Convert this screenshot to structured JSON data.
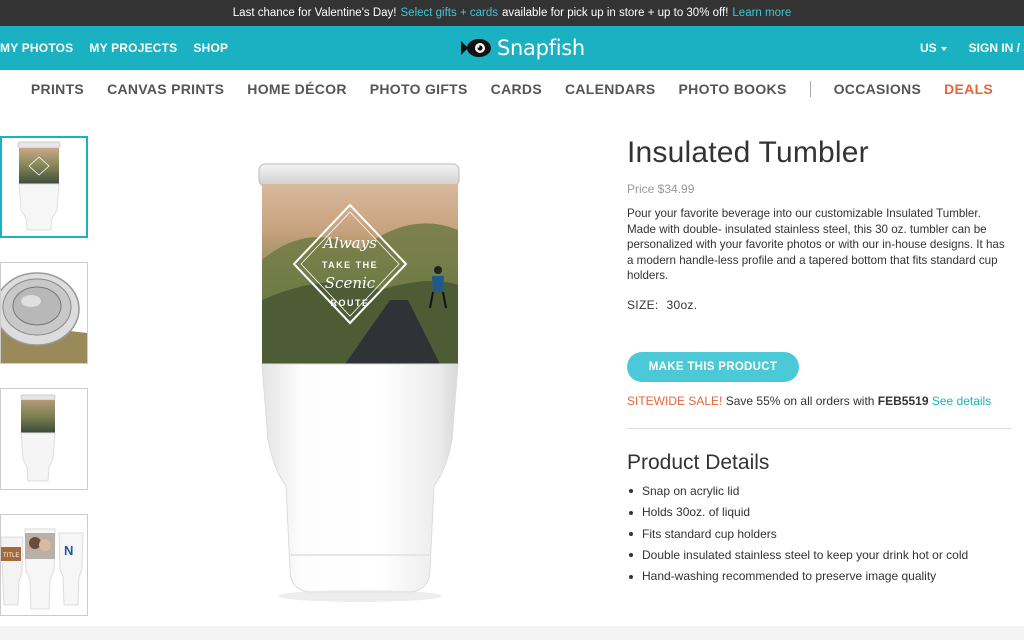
{
  "promo": {
    "text_a": "Last chance for Valentine's Day!",
    "link": "Select gifts + cards",
    "text_b": "available for pick up in store + up to 30% off!",
    "learn_more": "Learn more"
  },
  "topnav": {
    "items": [
      "MY PHOTOS",
      "MY PROJECTS",
      "SHOP"
    ],
    "brand": "Snapfish",
    "region": "US",
    "sign_in": "SIGN IN / J"
  },
  "catnav": {
    "items": [
      "PRINTS",
      "CANVAS PRINTS",
      "HOME DÉCOR",
      "PHOTO GIFTS",
      "CARDS",
      "CALENDARS",
      "PHOTO BOOKS"
    ],
    "occasions": "OCCASIONS",
    "deals": "DEALS"
  },
  "hero": {
    "design_line1": "Always",
    "design_line2": "TAKE THE",
    "design_line3": "Scenic",
    "design_line4": "ROUTE"
  },
  "product": {
    "title": "Insulated Tumbler",
    "price": "Price $34.99",
    "description": "Pour your favorite beverage into our customizable Insulated Tumbler. Made with double- insulated stainless steel, this 30 oz. tumbler can be personalized with your favorite photos or with our in-house designs. It has a modern handle-less profile and a tapered bottom that fits standard cup holders.",
    "size_label": "SIZE:",
    "size_value": "30oz.",
    "cta": "MAKE THIS PRODUCT",
    "sale_label": "SITEWIDE SALE!",
    "sale_text": "Save 55% on all orders with",
    "sale_code": "FEB5519",
    "sale_link": "See details"
  },
  "details": {
    "title": "Product Details",
    "items": [
      "Snap on acrylic lid",
      "Holds 30oz. of liquid",
      "Fits standard cup holders",
      "Double insulated stainless steel to keep your drink hot or cold",
      "Hand-washing recommended to preserve image quality"
    ]
  },
  "thumbnail_text": {
    "label_a": "TITLE",
    "label_b": "N"
  },
  "colors": {
    "teal": "#1ab1c2",
    "button": "#4cc9d6",
    "accent_red": "#e3663d",
    "dark_bar": "#333333"
  }
}
